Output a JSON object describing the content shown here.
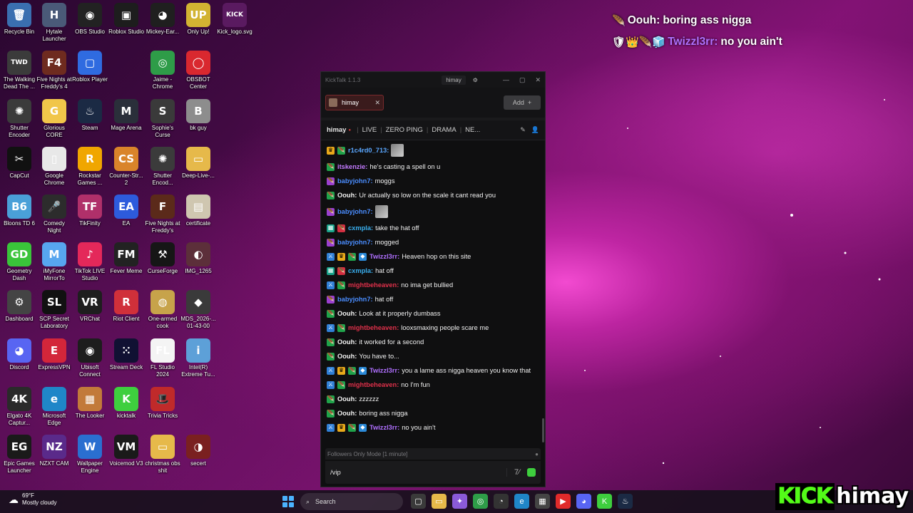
{
  "desktop_icons": [
    {
      "label": "Recycle Bin",
      "glyph": "🗑",
      "color": "#3a6fb0"
    },
    {
      "label": "Hytale Launcher",
      "glyph": "H",
      "color": "#4a5a78"
    },
    {
      "label": "OBS Studio",
      "glyph": "◉",
      "color": "#222222"
    },
    {
      "label": "Roblox Studio",
      "glyph": "▣",
      "color": "#1d1d1d"
    },
    {
      "label": "Mickey-Ear...",
      "glyph": "◕",
      "color": "#1f1f1f"
    },
    {
      "label": "Only Up!",
      "glyph": "UP",
      "color": "#d2b332"
    },
    {
      "label": "Kick_logo.svg",
      "glyph": "KICK",
      "color": "#5a1a60"
    },
    {
      "label": "The Walking Dead The ...",
      "glyph": "TWD",
      "color": "#3b3b3b"
    },
    {
      "label": "Five Nights at Freddy's 4",
      "glyph": "F4",
      "color": "#6e2b1f"
    },
    {
      "label": "Roblox Player",
      "glyph": "▢",
      "color": "#2f6be0"
    },
    {
      "label": "Jaime - Chrome",
      "glyph": "◎",
      "color": "#2e9c48"
    },
    {
      "label": "OBSBOT Center",
      "glyph": "◯",
      "color": "#d9282f"
    },
    {
      "label": "Shutter Encoder",
      "glyph": "✺",
      "color": "#3b3b3b"
    },
    {
      "label": "Glorious CORE",
      "glyph": "G",
      "color": "#f1c64a"
    },
    {
      "label": "Steam",
      "glyph": "♨",
      "color": "#1b2a44"
    },
    {
      "label": "Mage Arena",
      "glyph": "M",
      "color": "#2a2f3a"
    },
    {
      "label": "Sophie's Curse",
      "glyph": "S",
      "color": "#3a3a3a"
    },
    {
      "label": "bk guy",
      "glyph": "B",
      "color": "#8d8d8d"
    },
    {
      "label": "CapCut",
      "glyph": "✂",
      "color": "#111111"
    },
    {
      "label": "Google Chrome",
      "glyph": "▯",
      "color": "#e8e8e8"
    },
    {
      "label": "Rockstar Games ...",
      "glyph": "R",
      "color": "#f0a600"
    },
    {
      "label": "Counter-Str... 2",
      "glyph": "CS",
      "color": "#d9842a"
    },
    {
      "label": "Shutter Encod...",
      "glyph": "✺",
      "color": "#3b3b3b"
    },
    {
      "label": "Deep-Live-...",
      "glyph": "▭",
      "color": "#e6b94a"
    },
    {
      "label": "Bloons TD 6",
      "glyph": "B6",
      "color": "#4aa0d8"
    },
    {
      "label": "Comedy Night",
      "glyph": "🎤",
      "color": "#2c2c2c"
    },
    {
      "label": "TikFinity",
      "glyph": "TF",
      "color": "#b0306a"
    },
    {
      "label": "EA",
      "glyph": "EA",
      "color": "#2d5bdc"
    },
    {
      "label": "Five Nights at Freddy's",
      "glyph": "F",
      "color": "#5b2a1a"
    },
    {
      "label": "certificate",
      "glyph": "▤",
      "color": "#cfc6b0"
    },
    {
      "label": "Geometry Dash",
      "glyph": "GD",
      "color": "#3ac43a"
    },
    {
      "label": "iMyFone MirrorTo",
      "glyph": "M",
      "color": "#57a6ef"
    },
    {
      "label": "TikTok LIVE Studio",
      "glyph": "♪",
      "color": "#e4285a"
    },
    {
      "label": "Fever Meme",
      "glyph": "FM",
      "color": "#222222"
    },
    {
      "label": "CurseForge",
      "glyph": "⚒",
      "color": "#161616"
    },
    {
      "label": "IMG_1265",
      "glyph": "◐",
      "color": "#5c2f3a"
    },
    {
      "label": "Dashboard",
      "glyph": "⚙",
      "color": "#444444"
    },
    {
      "label": "SCP Secret Laboratory",
      "glyph": "SL",
      "color": "#111111"
    },
    {
      "label": "VRChat",
      "glyph": "VR",
      "color": "#1e1e1e"
    },
    {
      "label": "Riot Client",
      "glyph": "R",
      "color": "#d0303a"
    },
    {
      "label": "One-armed cook",
      "glyph": "◍",
      "color": "#c7a34a"
    },
    {
      "label": "MDS_2026-... 01-43-00",
      "glyph": "◆",
      "color": "#3a3a3a"
    },
    {
      "label": "Discord",
      "glyph": "◕",
      "color": "#5865f2"
    },
    {
      "label": "ExpressVPN",
      "glyph": "E",
      "color": "#d3263a"
    },
    {
      "label": "Ubisoft Connect",
      "glyph": "◉",
      "color": "#1d1d1d"
    },
    {
      "label": "Stream Deck",
      "glyph": "⁙",
      "color": "#111133"
    },
    {
      "label": "FL Studio 2024",
      "glyph": "FL",
      "color": "#f4f4f4"
    },
    {
      "label": "Intel(R) Extreme Tu...",
      "glyph": "i",
      "color": "#5da0d8"
    },
    {
      "label": "Elgato 4K Captur...",
      "glyph": "4K",
      "color": "#2a2a2a"
    },
    {
      "label": "Microsoft Edge",
      "glyph": "e",
      "color": "#1f86c8"
    },
    {
      "label": "The Looker",
      "glyph": "▦",
      "color": "#c27a3a"
    },
    {
      "label": "kicktalk",
      "glyph": "K",
      "color": "#3ecf3e"
    },
    {
      "label": "Trivia Tricks",
      "glyph": "🎩",
      "color": "#c02a2a"
    },
    {
      "label": "Epic Games Launcher",
      "glyph": "EG",
      "color": "#1a1a1a"
    },
    {
      "label": "NZXT CAM",
      "glyph": "NZ",
      "color": "#5a2a8a"
    },
    {
      "label": "Wallpaper Engine",
      "glyph": "W",
      "color": "#2a6fd0"
    },
    {
      "label": "Voicemod V3",
      "glyph": "VM",
      "color": "#1a1a1a"
    },
    {
      "label": "christmas obs shit",
      "glyph": "▭",
      "color": "#e6b94a"
    },
    {
      "label": "secert",
      "glyph": "◑",
      "color": "#7a2020"
    }
  ],
  "overlay": {
    "lines": [
      {
        "badges": "🪶",
        "user": "Oouh:",
        "text": "boring ass nigga",
        "color": "#ffffff"
      },
      {
        "badges": "🛡👑🪶🧊",
        "user": "Twizzl3rr:",
        "text": "no you ain't",
        "color": "#b070ff"
      }
    ]
  },
  "window": {
    "app_title": "KickTalk 1.1.3",
    "title_user": "himay",
    "tab_label": "himay",
    "add_label": "Add",
    "channel_name": "himay",
    "channel_tags": [
      "LIVE",
      "ZERO PING",
      "DRAMA",
      "NE..."
    ],
    "mode_text": "Followers Only Mode [1 minute]",
    "input_value": "/vip"
  },
  "messages": [
    {
      "badges": [
        "vip",
        "sub"
      ],
      "user": "r1c4rd0_713:",
      "color": "#5aa7ff",
      "text": "",
      "emote": true
    },
    {
      "badges": [
        "sub"
      ],
      "user": "itskenzie:",
      "color": "#c37bff",
      "text": "he's casting a spell on u"
    },
    {
      "badges": [
        "sub2"
      ],
      "user": "babyjohn7:",
      "color": "#4a8dff",
      "text": "moggs"
    },
    {
      "badges": [
        "sub"
      ],
      "user": "Oouh:",
      "color": "#f2f2f2",
      "text": "Ur actually so low on the scale it cant read you"
    },
    {
      "badges": [
        "sub2"
      ],
      "user": "babyjohn7:",
      "color": "#4a8dff",
      "text": "",
      "emote": true
    },
    {
      "badges": [
        "og",
        "red"
      ],
      "user": "cxmpla:",
      "color": "#3ab0f0",
      "text": "take the hat off"
    },
    {
      "badges": [
        "sub2"
      ],
      "user": "babyjohn7:",
      "color": "#4a8dff",
      "text": "mogged"
    },
    {
      "badges": [
        "mod",
        "vip",
        "sub",
        "cube"
      ],
      "user": "Twizzl3rr:",
      "color": "#b070ff",
      "text": "Heaven hop on this site"
    },
    {
      "badges": [
        "og",
        "red"
      ],
      "user": "cxmpla:",
      "color": "#3ab0f0",
      "text": "hat off"
    },
    {
      "badges": [
        "mod",
        "sub"
      ],
      "user": "mightbeheaven:",
      "color": "#e0304a",
      "text": "no ima get bullied"
    },
    {
      "badges": [
        "sub2"
      ],
      "user": "babyjohn7:",
      "color": "#4a8dff",
      "text": "hat off"
    },
    {
      "badges": [
        "sub"
      ],
      "user": "Oouh:",
      "color": "#f2f2f2",
      "text": "Look at it properly dumbass"
    },
    {
      "badges": [
        "mod",
        "sub"
      ],
      "user": "mightbeheaven:",
      "color": "#e0304a",
      "text": "looxsmaxing people scare me"
    },
    {
      "badges": [
        "sub"
      ],
      "user": "Oouh:",
      "color": "#f2f2f2",
      "text": "it worked for a second"
    },
    {
      "badges": [
        "sub"
      ],
      "user": "Oouh:",
      "color": "#f2f2f2",
      "text": "You have to..."
    },
    {
      "badges": [
        "mod",
        "vip",
        "sub",
        "cube"
      ],
      "user": "Twizzl3rr:",
      "color": "#b070ff",
      "text": "you a lame ass nigga heaven you know that"
    },
    {
      "badges": [
        "mod",
        "sub"
      ],
      "user": "mightbeheaven:",
      "color": "#e0304a",
      "text": "no I'm fun"
    },
    {
      "badges": [
        "sub"
      ],
      "user": "Oouh:",
      "color": "#f2f2f2",
      "text": "zzzzzz"
    },
    {
      "badges": [
        "sub"
      ],
      "user": "Oouh:",
      "color": "#f2f2f2",
      "text": "boring ass nigga"
    },
    {
      "badges": [
        "mod",
        "vip",
        "sub",
        "cube"
      ],
      "user": "Twizzl3rr:",
      "color": "#b070ff",
      "text": "no you ain't"
    }
  ],
  "taskbar": {
    "temperature": "69°F",
    "weather": "Mostly cloudy",
    "search_placeholder": "Search",
    "apps": [
      {
        "name": "task-view",
        "glyph": "▢",
        "color": "#3a3a3a"
      },
      {
        "name": "file-explorer",
        "glyph": "▭",
        "color": "#e6b94a"
      },
      {
        "name": "copilot",
        "glyph": "✦",
        "color": "#8a5ad8"
      },
      {
        "name": "chrome",
        "glyph": "◎",
        "color": "#2e9c48"
      },
      {
        "name": "steam-helper",
        "glyph": "◔",
        "color": "#333333"
      },
      {
        "name": "edge",
        "glyph": "e",
        "color": "#1f86c8"
      },
      {
        "name": "store",
        "glyph": "▦",
        "color": "#444444"
      },
      {
        "name": "youtube",
        "glyph": "▶",
        "color": "#e02a2a"
      },
      {
        "name": "discord",
        "glyph": "◕",
        "color": "#5865f2"
      },
      {
        "name": "kicktalk",
        "glyph": "K",
        "color": "#3ecf3e"
      },
      {
        "name": "steam",
        "glyph": "♨",
        "color": "#1b2a44"
      }
    ]
  },
  "brand": {
    "kick": "KICK",
    "name": "himay"
  }
}
